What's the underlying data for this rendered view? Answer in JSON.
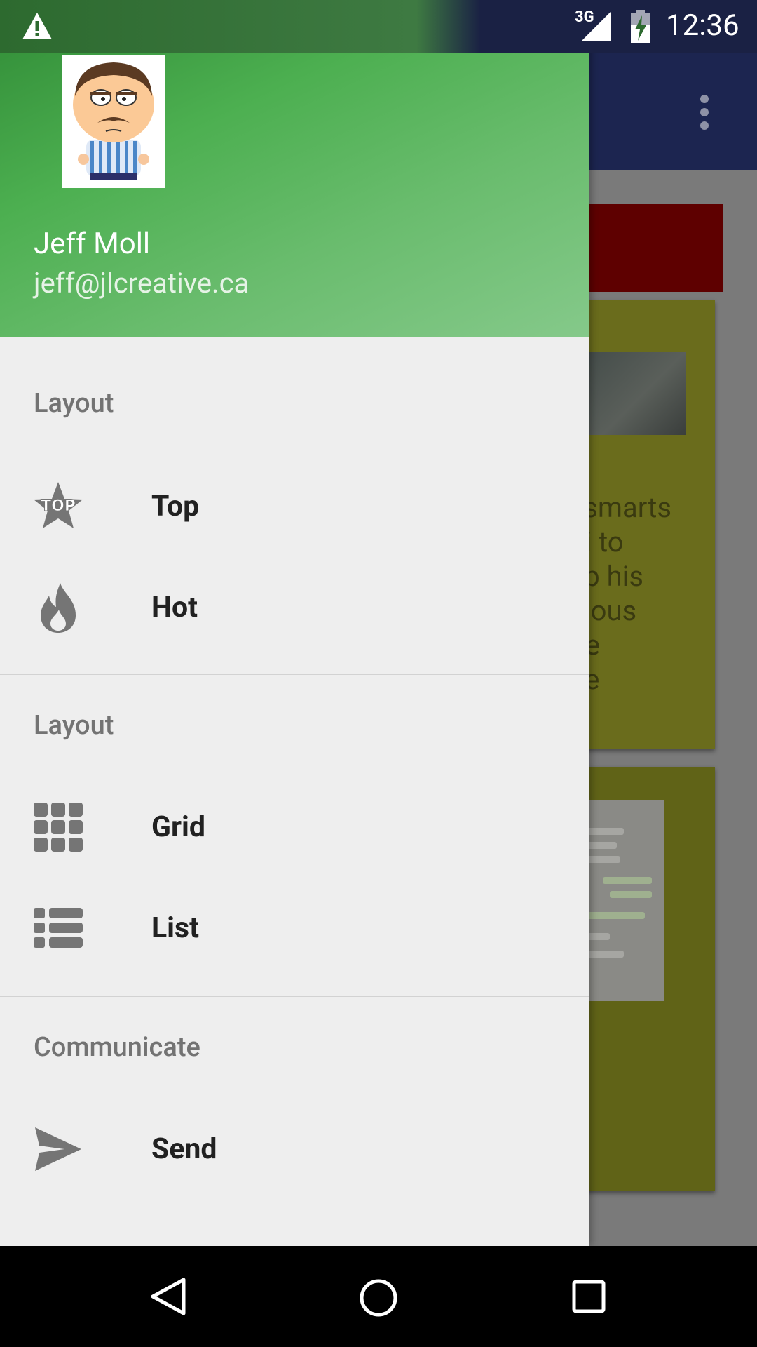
{
  "status_bar": {
    "network": "3G",
    "time": "12:36"
  },
  "drawer": {
    "user": {
      "name": "Jeff Moll",
      "email": "jeff@jlcreative.ca"
    },
    "sections": [
      {
        "title": "Layout",
        "items": [
          {
            "label": "Top",
            "icon": "top-star-icon"
          },
          {
            "label": "Hot",
            "icon": "flame-icon"
          }
        ]
      },
      {
        "title": "Layout",
        "items": [
          {
            "label": "Grid",
            "icon": "grid-icon"
          },
          {
            "label": "List",
            "icon": "list-icon"
          }
        ]
      },
      {
        "title": "Communicate",
        "items": [
          {
            "label": "Send",
            "icon": "send-icon"
          }
        ]
      }
    ]
  },
  "background_app": {
    "card_text": "o\nksmarts\ngi to\nep his\ncious\nite\nne"
  },
  "colors": {
    "header_green": "#4caf50",
    "toolbar_navy": "#1c2550",
    "drawer_bg": "#eeeeee"
  }
}
